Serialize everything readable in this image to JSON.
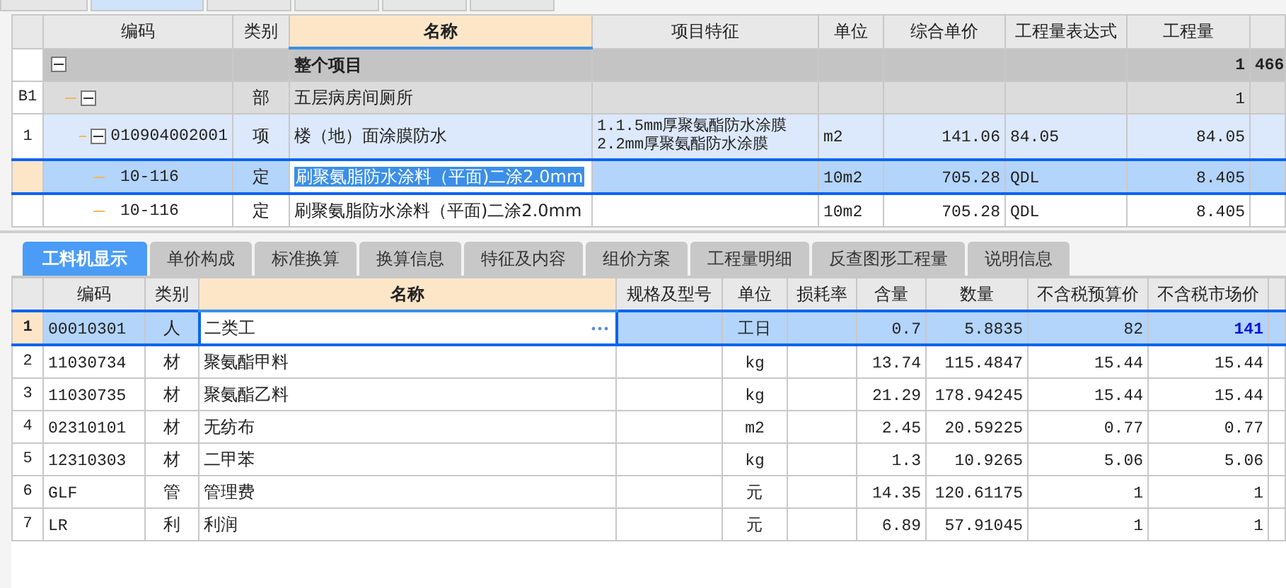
{
  "top_tabs": [
    {
      "selected": false
    },
    {
      "selected": true
    },
    {
      "selected": false
    },
    {
      "selected": false
    },
    {
      "selected": false
    },
    {
      "selected": false
    }
  ],
  "upper_table": {
    "columns": [
      {
        "label": "编码",
        "selected": false
      },
      {
        "label": "类别",
        "selected": false
      },
      {
        "label": "名称",
        "selected": true
      },
      {
        "label": "项目特征",
        "selected": false
      },
      {
        "label": "单位",
        "selected": false
      },
      {
        "label": "综合单价",
        "selected": false
      },
      {
        "label": "工程量表达式",
        "selected": false
      },
      {
        "label": "工程量",
        "selected": false
      }
    ],
    "rows": [
      {
        "kind": "project",
        "name": "整个项目",
        "quantity": "1",
        "column_9": "466",
        "expanded": true,
        "selected": false,
        "children": [
          {
            "kind": "section",
            "number": "B1",
            "type": "部",
            "name": "五层病房间厕所",
            "quantity": "1",
            "expanded": true,
            "selected": false,
            "children": [
              {
                "kind": "item",
                "number": "1",
                "code": "010904002001",
                "type": "项",
                "name": "楼（地）面涂膜防水",
                "features": [
                  "1.1.5mm厚聚氨酯防水涂膜",
                  "2.2mm厚聚氨酯防水涂膜"
                ],
                "unit": "m2",
                "price": "141.06",
                "expression": "84.05",
                "quantity": "84.05",
                "expanded": true,
                "selected": false,
                "children": [
                  {
                    "kind": "norm",
                    "code": "10-116",
                    "type": "定",
                    "name": "刷聚氨脂防水涂料（平面)二涂2.0mm",
                    "unit": "10m2",
                    "price": "705.28",
                    "expression": "QDL",
                    "quantity": "8.405",
                    "selected": true
                  },
                  {
                    "kind": "norm",
                    "code": "10-116",
                    "type": "定",
                    "name": "刷聚氨脂防水涂料（平面)二涂2.0mm",
                    "unit": "10m2",
                    "price": "705.28",
                    "expression": "QDL",
                    "quantity": "8.405",
                    "selected": false
                  }
                ]
              }
            ]
          }
        ]
      }
    ]
  },
  "detail_tabs": [
    {
      "label": "工料机显示",
      "selected": true
    },
    {
      "label": "单价构成",
      "selected": false
    },
    {
      "label": "标准换算",
      "selected": false
    },
    {
      "label": "换算信息",
      "selected": false
    },
    {
      "label": "特征及内容",
      "selected": false
    },
    {
      "label": "组价方案",
      "selected": false
    },
    {
      "label": "工程量明细",
      "selected": false
    },
    {
      "label": "反查图形工程量",
      "selected": false
    },
    {
      "label": "说明信息",
      "selected": false
    }
  ],
  "detail_table": {
    "columns": [
      {
        "label": "编码",
        "selected": false
      },
      {
        "label": "类别",
        "selected": false
      },
      {
        "label": "名称",
        "selected": true
      },
      {
        "label": "规格及型号",
        "selected": false
      },
      {
        "label": "单位",
        "selected": false
      },
      {
        "label": "损耗率",
        "selected": false
      },
      {
        "label": "含量",
        "selected": false
      },
      {
        "label": "数量",
        "selected": false
      },
      {
        "label": "不含税预算价",
        "selected": false
      },
      {
        "label": "不含税市场价",
        "selected": false
      }
    ],
    "rows": [
      {
        "number": "1",
        "code": "00010301",
        "type": "人",
        "name": "二类工",
        "unit": "工日",
        "content": "0.7",
        "amount": "5.8835",
        "budget_price": "82",
        "market_price": "141",
        "price_modified": true,
        "selected": true
      },
      {
        "number": "2",
        "code": "11030734",
        "type": "材",
        "name": "聚氨酯甲料",
        "unit": "kg",
        "content": "13.74",
        "amount": "115.4847",
        "budget_price": "15.44",
        "market_price": "15.44",
        "price_modified": false,
        "selected": false
      },
      {
        "number": "3",
        "code": "11030735",
        "type": "材",
        "name": "聚氨酯乙料",
        "unit": "kg",
        "content": "21.29",
        "amount": "178.94245",
        "budget_price": "15.44",
        "market_price": "15.44",
        "price_modified": false,
        "selected": false
      },
      {
        "number": "4",
        "code": "02310101",
        "type": "材",
        "name": "无纺布",
        "unit": "m2",
        "content": "2.45",
        "amount": "20.59225",
        "budget_price": "0.77",
        "market_price": "0.77",
        "price_modified": false,
        "selected": false
      },
      {
        "number": "5",
        "code": "12310303",
        "type": "材",
        "name": "二甲苯",
        "unit": "kg",
        "content": "1.3",
        "amount": "10.9265",
        "budget_price": "5.06",
        "market_price": "5.06",
        "price_modified": false,
        "selected": false
      },
      {
        "number": "6",
        "code": "GLF",
        "type": "管",
        "name": "管理费",
        "unit": "元",
        "content": "14.35",
        "amount": "120.61175",
        "budget_price": "1",
        "market_price": "1",
        "price_modified": false,
        "selected": false
      },
      {
        "number": "7",
        "code": "LR",
        "type": "利",
        "name": "利润",
        "unit": "元",
        "content": "6.89",
        "amount": "57.91045",
        "budget_price": "1",
        "market_price": "1",
        "price_modified": false,
        "selected": false
      }
    ]
  }
}
